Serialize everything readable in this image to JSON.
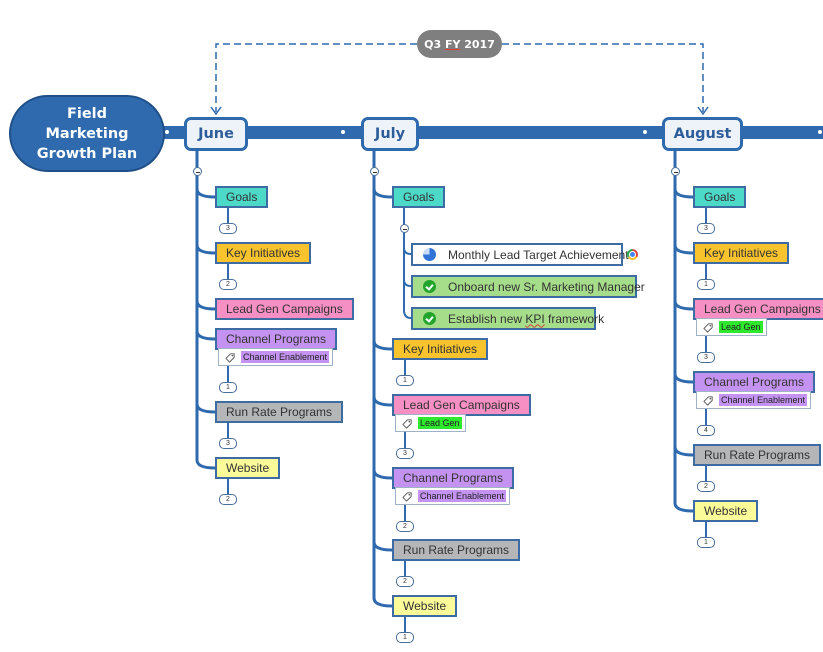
{
  "root": {
    "title": "Field Marketing Growth Plan"
  },
  "quarter": {
    "prefix": "Q3 ",
    "fy": "FY",
    "suffix": " 2017"
  },
  "colors": {
    "spine": "#2e6aad",
    "goals": "#4dd9c8",
    "key_initiatives": "#f8c32c",
    "lead_gen": "#f68fc3",
    "channel": "#c493f1",
    "run_rate": "#b5b6b8",
    "website": "#fbfb9a",
    "completed_task": "#a6dd8a",
    "tag_lead_gen": "#2ee82e",
    "quarter_badge": "#7f7f7f"
  },
  "months": [
    {
      "name": "June",
      "topics": [
        {
          "label": "Goals",
          "count": "3"
        },
        {
          "label": "Key Initiatives",
          "count": "2"
        },
        {
          "label": "Lead Gen Campaigns"
        },
        {
          "label": "Channel Programs",
          "tag": "Channel Enablement",
          "count": "1"
        },
        {
          "label": "Run Rate Programs",
          "count": "3"
        },
        {
          "label": "Website",
          "count": "2"
        }
      ]
    },
    {
      "name": "July",
      "topics": [
        {
          "label": "Goals",
          "children": [
            {
              "label": "Monthly Lead Target Achievement",
              "icon": "progress-pie-icon",
              "progress": "75%"
            },
            {
              "label": "Onboard new Sr. Marketing Manager",
              "icon": "check-icon"
            },
            {
              "label_pre": "Establish new ",
              "label_kpi": "KPI",
              "label_post": " framework",
              "icon": "check-icon"
            }
          ]
        },
        {
          "label": "Key Initiatives",
          "count": "1"
        },
        {
          "label": "Lead Gen Campaigns",
          "tag": "Lead Gen",
          "count": "3"
        },
        {
          "label": "Channel Programs",
          "tag": "Channel Enablement",
          "count": "2"
        },
        {
          "label": "Run Rate Programs",
          "count": "2"
        },
        {
          "label": "Website",
          "count": "1"
        }
      ]
    },
    {
      "name": "August",
      "topics": [
        {
          "label": "Goals",
          "count": "3"
        },
        {
          "label": "Key Initiatives",
          "count": "1"
        },
        {
          "label": "Lead Gen Campaigns",
          "tag": "Lead Gen",
          "count": "3"
        },
        {
          "label": "Channel Programs",
          "tag": "Channel Enablement",
          "count": "4"
        },
        {
          "label": "Run Rate Programs",
          "count": "2"
        },
        {
          "label": "Website",
          "count": "1"
        }
      ]
    }
  ]
}
